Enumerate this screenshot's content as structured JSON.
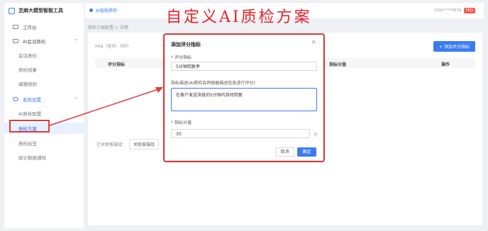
{
  "app": {
    "brand": "芝麻大模型智能工具"
  },
  "sidebar": {
    "items": [
      {
        "label": "工作台"
      },
      {
        "label": "AI会话质检",
        "children": [
          "会话质检",
          "质检结果",
          "编辑规则"
        ]
      },
      {
        "label": "系统设置",
        "children": [
          "AI质检配置",
          "质检方案",
          "质检标签",
          "统计数据通知"
        ]
      }
    ]
  },
  "topbar": {
    "tab": "AI智能质检",
    "user": "1591****5678",
    "badge": "PRO"
  },
  "breadcrumb": "质检方案配置  >  详情",
  "main": {
    "scheme_info": "mia（总分：0分）",
    "add_button": "+ 添加评分指标",
    "columns": [
      "评分指标",
      "指标分值",
      "操作"
    ],
    "receipt_label": "已关联客服组：",
    "receipt_value": "关联客服组"
  },
  "overlay_title": "自定义AI质检方案",
  "dialog": {
    "title": "添加评分指标",
    "close": "×",
    "field1_label": "评分指标",
    "field1_value": "5分钟回复率",
    "field2_label": "指标描述(AI质检会将根据描述信息进行评分)",
    "field2_value": "在客户发送消息的5分钟内及时回复",
    "field3_label": "指标分值",
    "field3_value": "30",
    "field3_unit": "分",
    "cancel": "取消",
    "confirm": "确定"
  },
  "colors": {
    "accent": "#3b7cf0",
    "annotation": "#e33a3a"
  }
}
